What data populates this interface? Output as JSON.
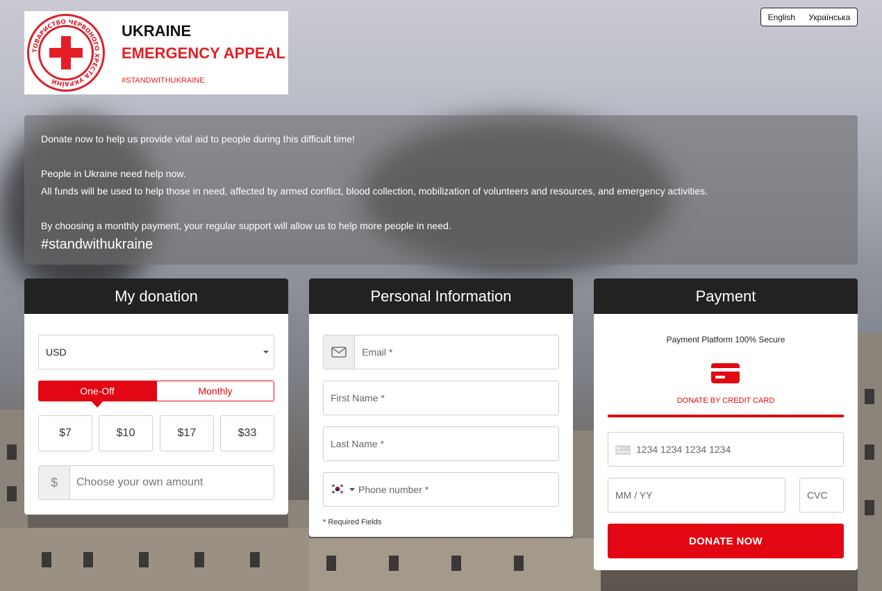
{
  "logo": {
    "title_line1": "UKRAINE",
    "title_line2": "EMERGENCY APPEAL",
    "tagline": "#STANDWITHUKRAINE",
    "seal_text": "ТОВАРИСТВО ЧЕРВОНОГО ХРЕСТА УКРАЇНИ"
  },
  "language": {
    "options": [
      "English",
      "Українська"
    ]
  },
  "intro": {
    "line1": "Donate now to help us provide vital aid to people during this difficult time!",
    "line2": "People in Ukraine need help now.",
    "line3": "All funds will be used to help those in need, affected by armed conflict, blood collection, mobilization of volunteers and resources, and emergency activities.",
    "line4": "By choosing a monthly payment, your regular support will allow us to help more people in need.",
    "hashtag": "#standwithukraine"
  },
  "donation": {
    "title": "My donation",
    "currency": "USD",
    "frequency": {
      "selected": "One-Off",
      "options": [
        "One-Off",
        "Monthly"
      ]
    },
    "amounts": [
      "$7",
      "$10",
      "$17",
      "$33"
    ],
    "custom_symbol": "$",
    "custom_placeholder": "Choose your own amount"
  },
  "personal": {
    "title": "Personal Information",
    "email_placeholder": "Email *",
    "first_name_placeholder": "First Name *",
    "last_name_placeholder": "Last Name *",
    "phone_placeholder": "Phone number *",
    "required_note": "* Required Fields"
  },
  "payment": {
    "title": "Payment",
    "secure_text": "Payment Platform 100% Secure",
    "method_label": "DONATE BY CREDIT CARD",
    "card_placeholder": "1234 1234 1234 1234",
    "expiry_placeholder": "MM / YY",
    "cvc_placeholder": "CVC",
    "submit_label": "DONATE NOW"
  },
  "colors": {
    "accent": "#e30613",
    "header_dark": "#222222"
  },
  "icons": [
    "envelope-icon",
    "credit-card-icon",
    "card-brand-icon",
    "flag-icon",
    "chevron-down-icon"
  ]
}
